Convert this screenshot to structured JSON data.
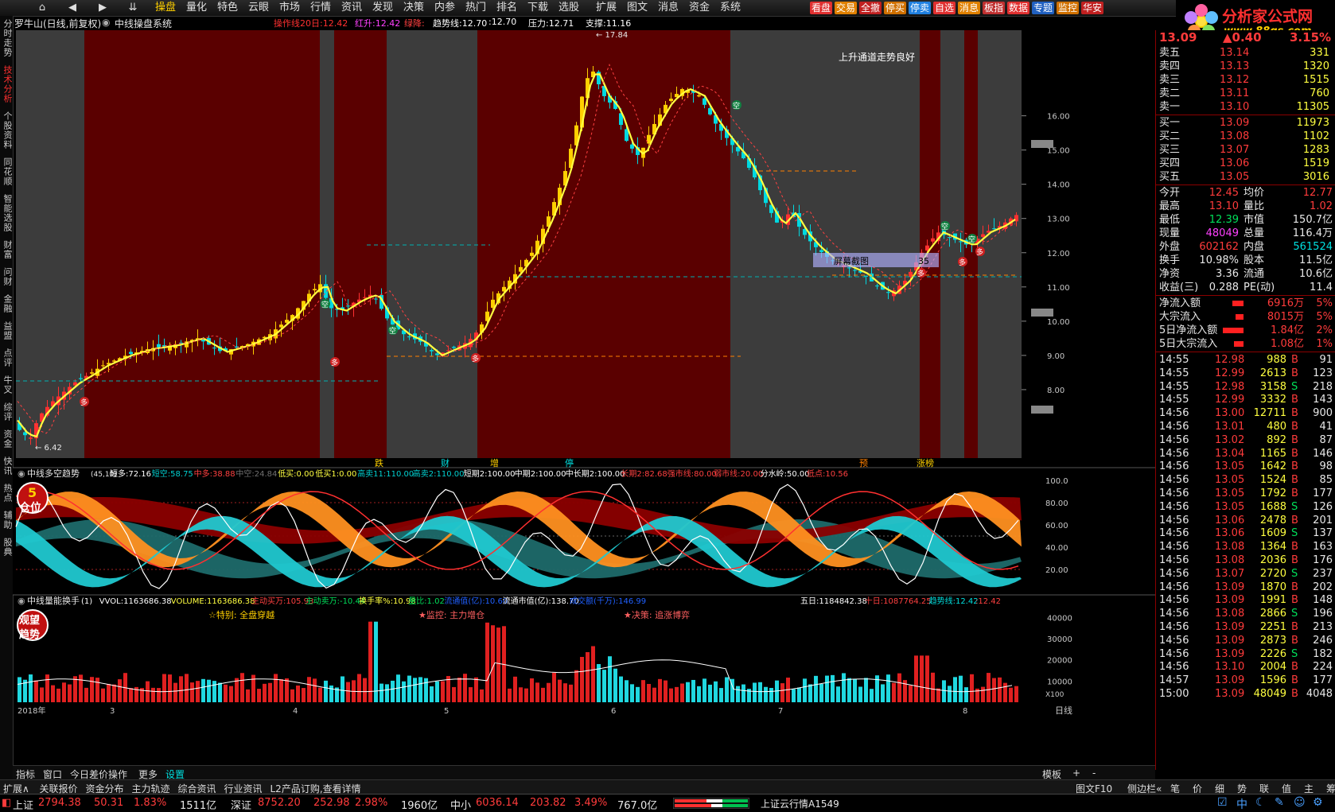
{
  "nav_icons": [
    "home-icon",
    "back-icon",
    "forward-icon",
    "expand-icon"
  ],
  "menu": [
    "操盘",
    "量化",
    "特色",
    "云眼",
    "市场",
    "行情",
    "资讯",
    "发现",
    "决策",
    "内参",
    "热门",
    "排名",
    "下载",
    "选股",
    "扩展",
    "图文",
    "消息",
    "资金",
    "系统"
  ],
  "menu_active": "操盘",
  "tool_buttons": [
    {
      "label": "看盘",
      "color": "#e03030"
    },
    {
      "label": "交易",
      "color": "#e08000"
    },
    {
      "label": "全撤",
      "color": "#c02020"
    },
    {
      "label": "停买",
      "color": "#d07000"
    },
    {
      "label": "停卖",
      "color": "#2080e0"
    },
    {
      "label": "自选",
      "color": "#e03030"
    },
    {
      "label": "消息",
      "color": "#e08000"
    },
    {
      "label": "板指",
      "color": "#c03030"
    },
    {
      "label": "数据",
      "color": "#e03030"
    },
    {
      "label": "专题",
      "color": "#2060c0"
    },
    {
      "label": "监控",
      "color": "#d07000"
    },
    {
      "label": "华安",
      "color": "#c02020"
    }
  ],
  "logo": {
    "title": "分析家公式网",
    "url": "www.88gs.com"
  },
  "title": {
    "stock": "罗牛山(日线,前复权)",
    "system": "中线操盘系统"
  },
  "indicator_line": [
    {
      "text": "操作线20日:12.42",
      "color": "#ff3030"
    },
    {
      "text": "红升:12.42",
      "color": "#ff40ff"
    },
    {
      "text": "绿降:",
      "color": "#ff4040"
    },
    {
      "text": "趋势线:12.70",
      "color": "#ffffff"
    },
    {
      "text": ":12.70",
      "color": "#ffffff"
    },
    {
      "text": "压力:12.71",
      "color": "#ffffff"
    },
    {
      "text": "支撑:11.16",
      "color": "#ffffff"
    }
  ],
  "left_tabs": [
    "分时走势",
    "技术分析",
    "个股资料",
    "同花顺",
    "智能选股",
    "财富",
    "问财",
    "金融",
    "益盟",
    "点评",
    "牛叉",
    "综评",
    "资金",
    "快讯",
    "热点",
    "辅助",
    "股典"
  ],
  "left_tab_active": "技术分析",
  "main_chart": {
    "price_axis": [
      "16.00",
      "15.00",
      "14.00",
      "13.00",
      "12.00",
      "11.00",
      "10.00",
      "9.00",
      "8.00"
    ],
    "high_label": "17.84",
    "low_label": "6.42",
    "annotation": "上升通道走势良好",
    "screenshot_label": "屏幕截图",
    "screenshot_num": "35",
    "event_labels": [
      "跌",
      "财",
      "增",
      "停",
      "预",
      "涨榜"
    ],
    "badge_duo": "多",
    "badge_kong": "空"
  },
  "mid_panel": {
    "title": "中线多空趋势",
    "params": "(45,10)",
    "items": [
      {
        "text": "短多:72.16",
        "color": "#ffffff"
      },
      {
        "text": "短空:58.75",
        "color": "#00d0d0"
      },
      {
        "text": "中多:38.88",
        "color": "#ff4040"
      },
      {
        "text": "中空:24.84",
        "color": "#707070"
      },
      {
        "text": "低买:0.00",
        "color": "#ffff40"
      },
      {
        "text": "低买1:0.00",
        "color": "#ffff40"
      },
      {
        "text": "高卖11:110.00",
        "color": "#00d0d0"
      },
      {
        "text": "高卖2:110.00",
        "color": "#00d0d0"
      },
      {
        "text": "短期2:100.00",
        "color": "#ffffff"
      },
      {
        "text": "中期2:100.00",
        "color": "#ffffff"
      },
      {
        "text": "中长期2:100.00",
        "color": "#ffffff"
      },
      {
        "text": "长期2:82.68",
        "color": "#ff4040"
      },
      {
        "text": "强市线:80.00",
        "color": "#ff4040"
      },
      {
        "text": "弱市线:20.00",
        "color": "#ff4040"
      },
      {
        "text": "分水岭:50.00",
        "color": "#ffffff"
      },
      {
        "text": "低点:10.56",
        "color": "#ff4040"
      }
    ],
    "axis": [
      "100.0",
      "80.00",
      "60.00",
      "40.00",
      "20.00"
    ],
    "badge": "仓位",
    "badge_num": "5"
  },
  "vol_panel": {
    "title": "中线量能换手",
    "items": [
      {
        "text": "(1)",
        "color": "#ffffff"
      },
      {
        "text": "VVOL:1163686.38",
        "color": "#ffffff"
      },
      {
        "text": "VOLUME:1163686.38",
        "color": "#ffff40"
      },
      {
        "text": "主动买万:105.93",
        "color": "#ff4040"
      },
      {
        "text": "主动卖万:-10.44",
        "color": "#00e05a"
      },
      {
        "text": "换手率%:10.98",
        "color": "#ffff40"
      },
      {
        "text": "量比:1.02",
        "color": "#00e05a"
      },
      {
        "text": "流通值(亿):10.60",
        "color": "#2060ff"
      },
      {
        "text": "流通市值(亿):138.70",
        "color": "#ffffff"
      },
      {
        "text": "成交额(千万):146.99",
        "color": "#2060ff"
      }
    ],
    "right_items": [
      {
        "text": "五日:1184842.38",
        "color": "#ffffff"
      },
      {
        "text": "十日:1087764.25",
        "color": "#ff4040"
      },
      {
        "text": "趋势线:12.42",
        "color": "#00e0e0"
      },
      {
        "text": ":12.42",
        "color": "#ff4040"
      }
    ],
    "notes": [
      "☆特别: 全盘穿越",
      "★监控: 主力增仓",
      "★决策: 追涨博弈"
    ],
    "axis": [
      "40000",
      "30000",
      "20000",
      "10000"
    ],
    "unit": "X100",
    "badge": "观望趋势"
  },
  "x_axis": [
    "2018年",
    "3",
    "4",
    "5",
    "6",
    "7",
    "8"
  ],
  "period": "日线",
  "tabs": [
    "指标",
    "窗口",
    "今日差价操作",
    "更多",
    "设置"
  ],
  "tabs_right": [
    "模板",
    "+",
    "-"
  ],
  "quote": {
    "price": "13.09",
    "change": "▲0.40",
    "pct": "3.15%",
    "asks": [
      [
        "卖五",
        "13.14",
        "331"
      ],
      [
        "卖四",
        "13.13",
        "1320"
      ],
      [
        "卖三",
        "13.12",
        "1515"
      ],
      [
        "卖二",
        "13.11",
        "760"
      ],
      [
        "卖一",
        "13.10",
        "11305"
      ]
    ],
    "bids": [
      [
        "买一",
        "13.09",
        "11973"
      ],
      [
        "买二",
        "13.08",
        "1102"
      ],
      [
        "买三",
        "13.07",
        "1283"
      ],
      [
        "买四",
        "13.06",
        "1519"
      ],
      [
        "买五",
        "13.05",
        "3016"
      ]
    ],
    "stats": [
      [
        "今开",
        "12.45",
        "均价",
        "12.77"
      ],
      [
        "最高",
        "13.10",
        "量比",
        "1.02"
      ],
      [
        "最低",
        "12.39",
        "市值",
        "150.7亿"
      ],
      [
        "现量",
        "48049",
        "总量",
        "116.4万"
      ],
      [
        "外盘",
        "602162",
        "内盘",
        "561524"
      ],
      [
        "换手",
        "10.98%",
        "股本",
        "11.5亿"
      ],
      [
        "净资",
        "3.36",
        "流通",
        "10.6亿"
      ],
      [
        "收益(三)",
        "0.288",
        "PE(动)",
        "11.4"
      ]
    ],
    "flows": [
      [
        "净流入额",
        "6916万",
        "5%"
      ],
      [
        "大宗流入",
        "8015万",
        "5%"
      ],
      [
        "5日净流入额",
        "1.84亿",
        "2%"
      ],
      [
        "5日大宗流入",
        "1.08亿",
        "1%"
      ]
    ],
    "ticks": [
      [
        "14:55",
        "12.98",
        "988",
        "B",
        "91"
      ],
      [
        "14:55",
        "12.99",
        "2613",
        "B",
        "123"
      ],
      [
        "14:55",
        "12.98",
        "3158",
        "S",
        "218"
      ],
      [
        "14:55",
        "12.99",
        "3332",
        "B",
        "143"
      ],
      [
        "14:56",
        "13.00",
        "12711",
        "B",
        "900"
      ],
      [
        "14:56",
        "13.01",
        "480",
        "B",
        "41"
      ],
      [
        "14:56",
        "13.02",
        "892",
        "B",
        "87"
      ],
      [
        "14:56",
        "13.04",
        "1165",
        "B",
        "146"
      ],
      [
        "14:56",
        "13.05",
        "1642",
        "B",
        "98"
      ],
      [
        "14:56",
        "13.05",
        "1524",
        "B",
        "85"
      ],
      [
        "14:56",
        "13.05",
        "1792",
        "B",
        "177"
      ],
      [
        "14:56",
        "13.05",
        "1688",
        "S",
        "126"
      ],
      [
        "14:56",
        "13.06",
        "2478",
        "B",
        "201"
      ],
      [
        "14:56",
        "13.06",
        "1609",
        "S",
        "137"
      ],
      [
        "14:56",
        "13.08",
        "1364",
        "B",
        "163"
      ],
      [
        "14:56",
        "13.08",
        "2036",
        "B",
        "176"
      ],
      [
        "14:56",
        "13.07",
        "2720",
        "S",
        "237"
      ],
      [
        "14:56",
        "13.09",
        "1870",
        "B",
        "202"
      ],
      [
        "14:56",
        "13.09",
        "1991",
        "B",
        "148"
      ],
      [
        "14:56",
        "13.08",
        "2866",
        "S",
        "196"
      ],
      [
        "14:56",
        "13.09",
        "2251",
        "B",
        "213"
      ],
      [
        "14:56",
        "13.09",
        "2873",
        "B",
        "246"
      ],
      [
        "14:56",
        "13.09",
        "2226",
        "S",
        "182"
      ],
      [
        "14:56",
        "13.10",
        "2004",
        "B",
        "224"
      ],
      [
        "14:57",
        "13.09",
        "1596",
        "B",
        "177"
      ],
      [
        "15:00",
        "13.09",
        "48049",
        "B",
        "4048"
      ]
    ]
  },
  "link_bar": [
    "扩展∧",
    "关联报价",
    "资金分布",
    "主力轨迹",
    "综合资讯",
    "行业资讯",
    "L2产品订购,查看详情"
  ],
  "link_bar_right": [
    "图文F10",
    "侧边栏«",
    "笔",
    "价",
    "细",
    "势",
    "联",
    "值",
    "主",
    "筹"
  ],
  "status": {
    "sh": {
      "name": "上证",
      "value": "2794.38",
      "chg": "50.31",
      "pct": "1.83%",
      "amt": "1511亿"
    },
    "sz": {
      "name": "深证",
      "value": "8752.20",
      "chg": "252.98",
      "pct": "2.98%",
      "amt": "1960亿"
    },
    "zx": {
      "name": "中小",
      "value": "6036.14",
      "chg": "203.82",
      "pct": "3.49%",
      "amt": "767.0亿"
    },
    "cloud": "上证云行情A1549",
    "right_icons": [
      "tray-icon-1",
      "中",
      "moon-icon",
      "settings-icon",
      "user-icon",
      "gear-icon"
    ]
  },
  "colors": {
    "up": "#ff3b3b",
    "down": "#00e05a",
    "bg_red": "#5a0000",
    "bg_gray": "#3c3c3c",
    "ma": "#ffff40",
    "cyan": "#00e0e0"
  }
}
